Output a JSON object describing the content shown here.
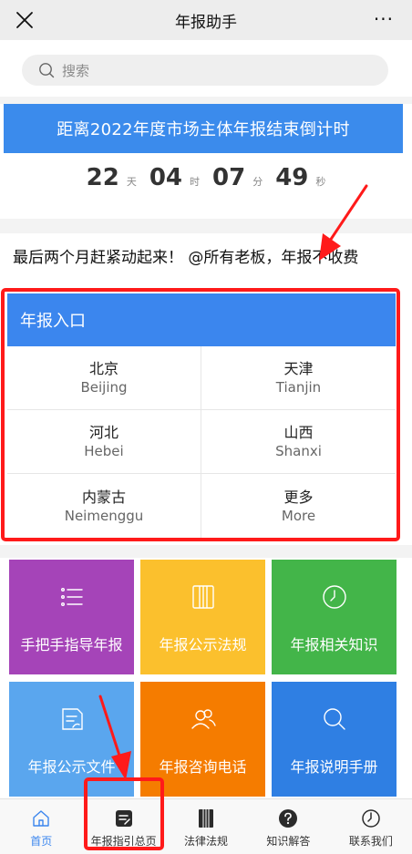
{
  "header": {
    "title": "年报助手",
    "more_label": "···"
  },
  "search": {
    "placeholder": "搜索"
  },
  "banner": {
    "text": "距离2022年度市场主体年报结束倒计时"
  },
  "countdown": {
    "days": "22",
    "days_unit": "天",
    "hours": "04",
    "hours_unit": "时",
    "minutes": "07",
    "minutes_unit": "分",
    "seconds": "49",
    "seconds_unit": "秒"
  },
  "ticker": {
    "text": "最后两个月赶紧动起来！  @所有老板，年报不收费"
  },
  "entry": {
    "title": "年报入口",
    "regions": [
      {
        "zh": "北京",
        "en": "Beijing"
      },
      {
        "zh": "天津",
        "en": "Tianjin"
      },
      {
        "zh": "河北",
        "en": "Hebei"
      },
      {
        "zh": "山西",
        "en": "Shanxi"
      },
      {
        "zh": "内蒙古",
        "en": "Neimenggu"
      },
      {
        "zh": "更多",
        "en": "More"
      }
    ]
  },
  "tiles": [
    {
      "label": "手把手指导年报",
      "icon": "list-icon",
      "color": "#a544b8"
    },
    {
      "label": "年报公示法规",
      "icon": "book-icon",
      "color": "#fbc02d"
    },
    {
      "label": "年报相关知识",
      "icon": "clock-icon",
      "color": "#43b549"
    },
    {
      "label": "年报公示文件",
      "icon": "document-icon",
      "color": "#5aa6ee"
    },
    {
      "label": "年报咨询电话",
      "icon": "contacts-icon",
      "color": "#f57c00"
    },
    {
      "label": "年报说明手册",
      "icon": "search-icon",
      "color": "#2f7fe3"
    }
  ],
  "tabbar": {
    "items": [
      {
        "label": "首页",
        "icon": "home-icon"
      },
      {
        "label": "年报指引总页",
        "icon": "guide-icon"
      },
      {
        "label": "法律法规",
        "icon": "law-book-icon"
      },
      {
        "label": "知识解答",
        "icon": "question-icon"
      },
      {
        "label": "联系我们",
        "icon": "contact-clock-icon"
      }
    ]
  },
  "colors": {
    "accent": "#3b86ee",
    "highlight": "#ff1a1a"
  }
}
